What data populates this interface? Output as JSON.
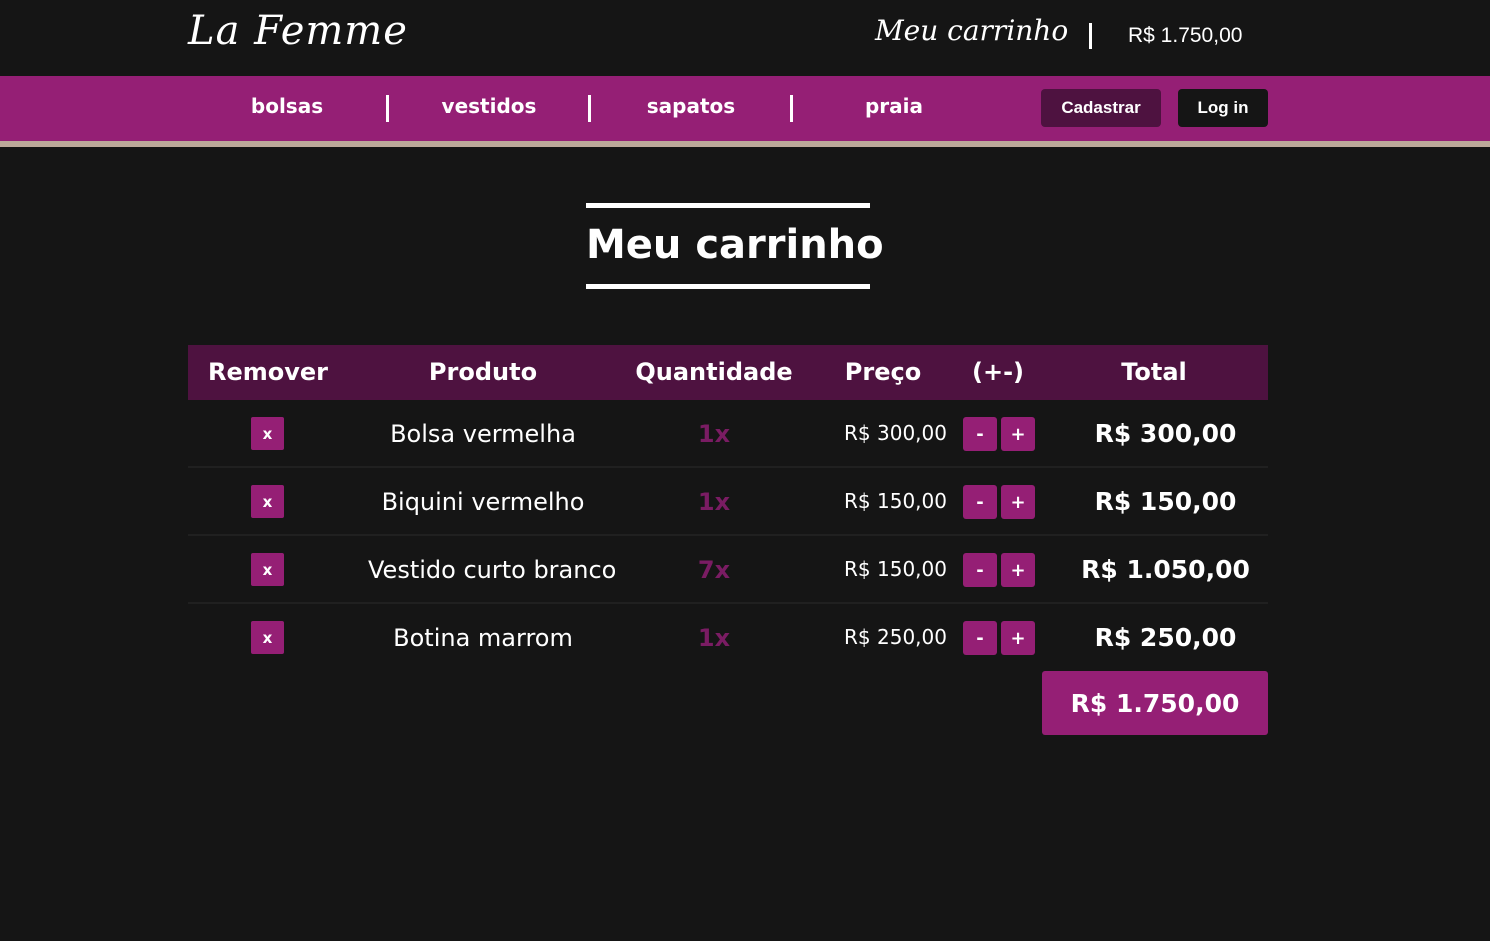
{
  "header": {
    "logo": "La Femme",
    "cart_link": "Meu carrinho",
    "cart_total": "R$ 1.750,00"
  },
  "nav": {
    "items": [
      "bolsas",
      "vestidos",
      "sapatos",
      "praia"
    ],
    "register_label": "Cadastrar",
    "login_label": "Log in"
  },
  "page_title": "Meu carrinho",
  "table": {
    "headers": [
      "Remover",
      "Produto",
      "Quantidade",
      "Preço",
      "(+-)",
      "Total"
    ],
    "rows": [
      {
        "remove": "x",
        "product": "Bolsa vermelha",
        "quantity": "1x",
        "price": "R$ 300,00",
        "minus": "-",
        "plus": "+",
        "total": "R$ 300,00"
      },
      {
        "remove": "x",
        "product": "Biquini vermelho",
        "quantity": "1x",
        "price": "R$ 150,00",
        "minus": "-",
        "plus": "+",
        "total": "R$ 150,00"
      },
      {
        "remove": "x",
        "product": "Vestido curto branco",
        "quantity": "7x",
        "price": "R$ 150,00",
        "minus": "-",
        "plus": "+",
        "total": "R$ 1.050,00"
      },
      {
        "remove": "x",
        "product": "Botina marrom",
        "quantity": "1x",
        "price": "R$ 250,00",
        "minus": "-",
        "plus": "+",
        "total": "R$ 250,00"
      }
    ],
    "grand_total": "R$ 1.750,00"
  },
  "colors": {
    "background": "#151515",
    "nav": "#951f75",
    "nav_border": "#bca99a",
    "table_header": "#4e1240",
    "accent": "#951f75",
    "quantity_text": "#7a1c63"
  }
}
